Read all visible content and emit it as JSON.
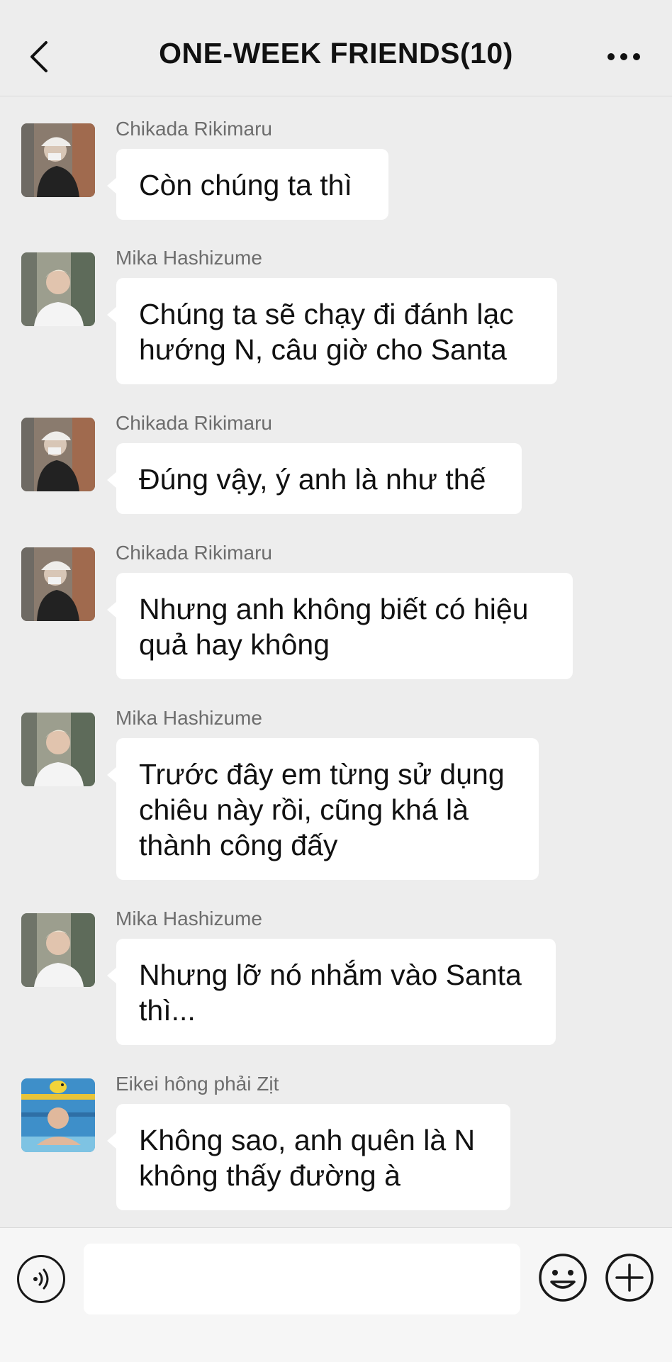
{
  "header": {
    "title": "ONE-WEEK FRIENDS(10)",
    "back_icon": "chevron-left-icon",
    "more_icon": "more-dots-icon"
  },
  "messages": [
    {
      "sender": "Chikada Rikimaru",
      "text": "Còn chúng ta thì",
      "avatar": "avatar-chikada"
    },
    {
      "sender": "Mika Hashizume",
      "text": "Chúng ta sẽ chạy đi đánh lạc hướng N, câu giờ cho Santa",
      "avatar": "avatar-mika"
    },
    {
      "sender": "Chikada Rikimaru",
      "text": "Đúng vậy, ý anh là như thế",
      "avatar": "avatar-chikada"
    },
    {
      "sender": "Chikada Rikimaru",
      "text": "Nhưng anh không biết có hiệu quả hay không",
      "avatar": "avatar-chikada"
    },
    {
      "sender": "Mika Hashizume",
      "text": "Trước đây em từng sử dụng chiêu này rồi, cũng khá là thành công đấy",
      "avatar": "avatar-mika"
    },
    {
      "sender": "Mika Hashizume",
      "text": "Nhưng lỡ nó nhắm vào Santa thì...",
      "avatar": "avatar-mika"
    },
    {
      "sender": "Eikei hông phải Zịt",
      "text": "Không sao, anh quên là N không thấy đường à",
      "avatar": "avatar-eikei"
    }
  ],
  "input_bar": {
    "input_value": "",
    "voice_icon": "voice-icon",
    "emoji_icon": "emoji-icon",
    "plus_icon": "plus-icon"
  },
  "colors": {
    "background": "#EDEDED",
    "bubble": "#FFFFFF",
    "sender_text": "#6D6D6D"
  }
}
